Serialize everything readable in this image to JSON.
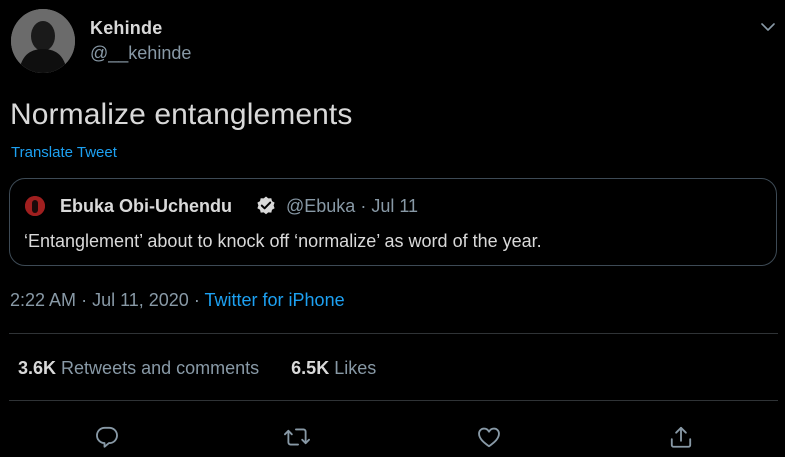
{
  "author": {
    "display_name": "Kehinde",
    "handle": "@__kehinde"
  },
  "tweet": {
    "text": "Normalize entanglements",
    "translate_label": "Translate Tweet"
  },
  "quoted_tweet": {
    "display_name": "Ebuka Obi-Uchendu",
    "handle": "@Ebuka",
    "separator": "·",
    "date": "Jul 11",
    "text": "‘Entanglement’ about to knock off ‘normalize’ as word of the year."
  },
  "meta": {
    "time": "2:22 AM",
    "sep1": "·",
    "date": "Jul 11, 2020",
    "sep2": "·",
    "source": "Twitter for iPhone"
  },
  "stats": {
    "retweets_count": "3.6K",
    "retweets_label": "Retweets and comments",
    "likes_count": "6.5K",
    "likes_label": "Likes"
  },
  "icons": {
    "caret": "chevron-down-icon",
    "verified": "verified-badge-icon",
    "reply": "reply-icon",
    "retweet": "retweet-icon",
    "like": "heart-icon",
    "share": "share-icon"
  },
  "colors": {
    "background": "#000000",
    "text": "#d9d9d9",
    "secondary": "#8899a6",
    "accent": "#1da1f2"
  }
}
